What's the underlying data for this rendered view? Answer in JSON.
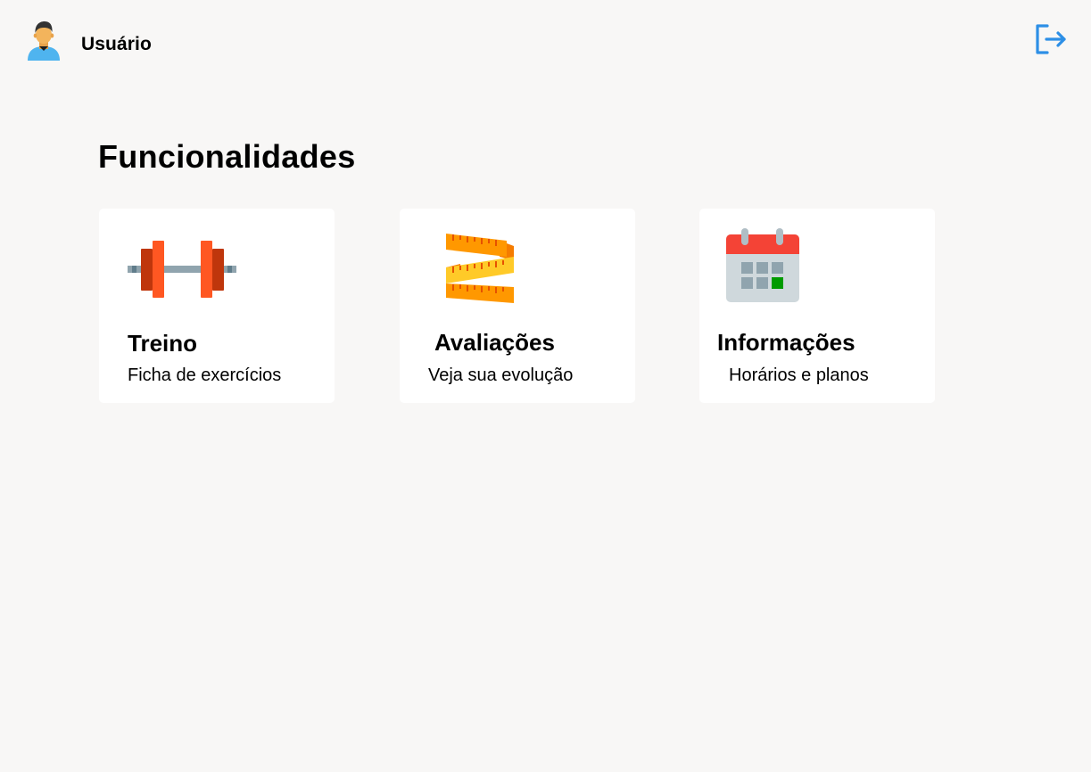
{
  "header": {
    "user_name": "Usuário",
    "avatar_icon": "user-avatar-icon",
    "logout_icon": "logout-icon",
    "accent_color": "#2d8fe6"
  },
  "main": {
    "title": "Funcionalidades",
    "cards": [
      {
        "title": "Treino",
        "subtitle": "Ficha de exercícios",
        "icon": "dumbbell-icon"
      },
      {
        "title": "Avaliações",
        "subtitle": "Veja sua evolução",
        "icon": "measuring-tape-icon"
      },
      {
        "title": "Informações",
        "subtitle": "Horários e planos",
        "icon": "calendar-icon"
      }
    ]
  }
}
